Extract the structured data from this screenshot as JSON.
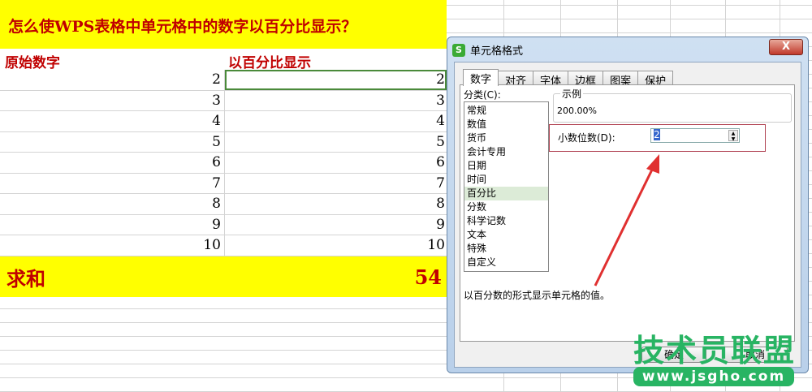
{
  "sheet": {
    "title": "怎么使WPS表格中单元格中的数字以百分比显示？",
    "col1_header": "原始数字",
    "col2_header": "以百分比显示",
    "rows": [
      [
        "2",
        "2"
      ],
      [
        "3",
        "3"
      ],
      [
        "4",
        "4"
      ],
      [
        "5",
        "5"
      ],
      [
        "6",
        "6"
      ],
      [
        "7",
        "7"
      ],
      [
        "8",
        "8"
      ],
      [
        "9",
        "9"
      ],
      [
        "10",
        "10"
      ]
    ],
    "sum_label": "求和",
    "sum_value": "54"
  },
  "dialog": {
    "title": "单元格格式",
    "close": "X",
    "tabs": [
      "数字",
      "对齐",
      "字体",
      "边框",
      "图案",
      "保护"
    ],
    "category_label": "分类(C):",
    "categories": [
      "常规",
      "数值",
      "货币",
      "会计专用",
      "日期",
      "时间",
      "百分比",
      "分数",
      "科学记数",
      "文本",
      "特殊",
      "自定义"
    ],
    "sample_label": "示例",
    "sample_value": "200.00%",
    "decimals_label": "小数位数(D):",
    "decimals_value": "2",
    "description": "以百分数的形式显示单元格的值。",
    "ok": "确定",
    "cancel": "取消"
  },
  "watermark": {
    "name": "技术员联盟",
    "url": "www.jsgho.com"
  },
  "colors": {
    "highlight": "#ffff00",
    "text_red": "#c00000",
    "arrow": "#e03030",
    "watermark": "#28b463"
  }
}
